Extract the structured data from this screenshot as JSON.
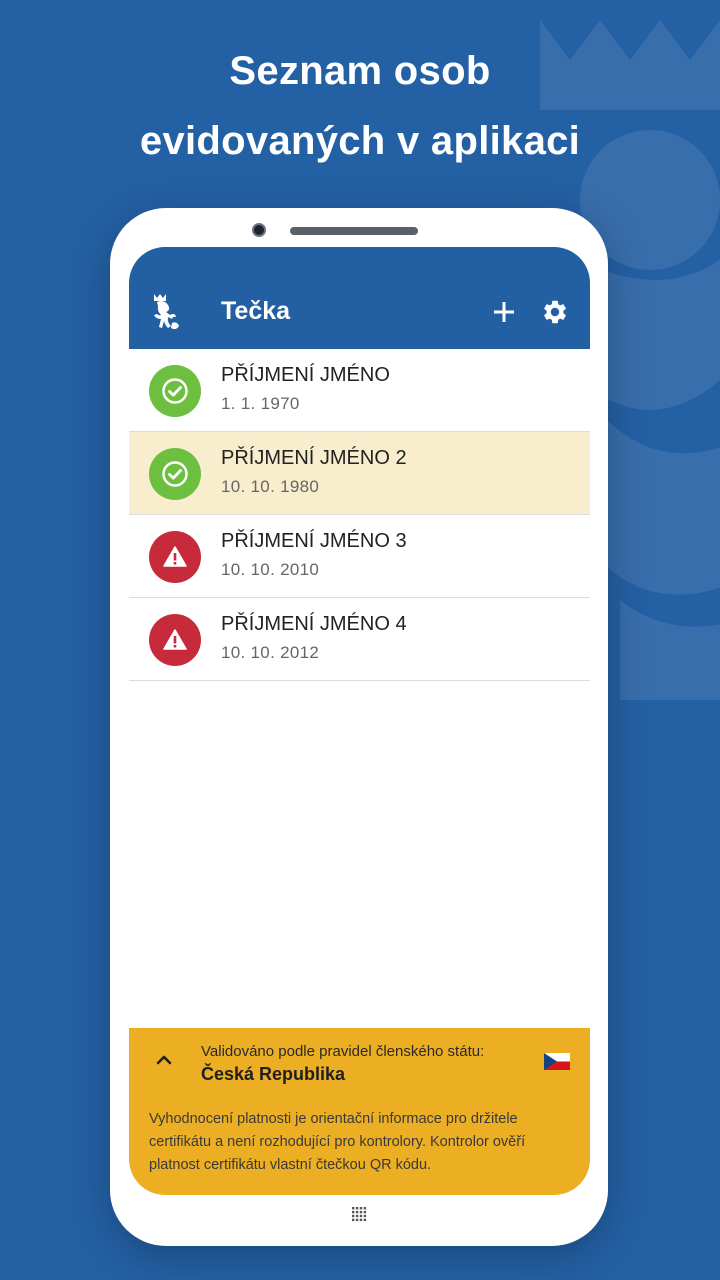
{
  "headline": {
    "line1": "Seznam osob",
    "line2": "evidovaných v aplikaci"
  },
  "app": {
    "title": "Tečka",
    "add_icon": "plus-icon",
    "settings_icon": "gear-icon",
    "logo_icon": "czech-lion-emblem"
  },
  "persons": [
    {
      "name": "PŘÍJMENÍ JMÉNO",
      "date": "1. 1. 1970",
      "status": "valid",
      "highlighted": false
    },
    {
      "name": "PŘÍJMENÍ JMÉNO 2",
      "date": "10. 10. 1980",
      "status": "valid",
      "highlighted": true
    },
    {
      "name": "PŘÍJMENÍ JMÉNO 3",
      "date": "10. 10. 2010",
      "status": "invalid",
      "highlighted": false
    },
    {
      "name": "PŘÍJMENÍ JMÉNO 4",
      "date": "10. 10. 2012",
      "status": "invalid",
      "highlighted": false
    }
  ],
  "footer": {
    "validated_label": "Validováno podle pravidel členského státu:",
    "country": "Česká Republika",
    "flag_icon": "czech-flag-icon",
    "disclaimer": "Vyhodnocení platnosti je orientační informace pro držitele certifikátu a není rozhodující pro kontrolory. Kontrolor ověří platnost certifikátu vlastní čtečkou QR kódu."
  },
  "colors": {
    "background": "#2460a4",
    "appbar": "#2360a3",
    "valid": "#6cbf3f",
    "invalid": "#c72a3a",
    "highlight_row": "#f8edcc",
    "footer": "#ecae22"
  }
}
